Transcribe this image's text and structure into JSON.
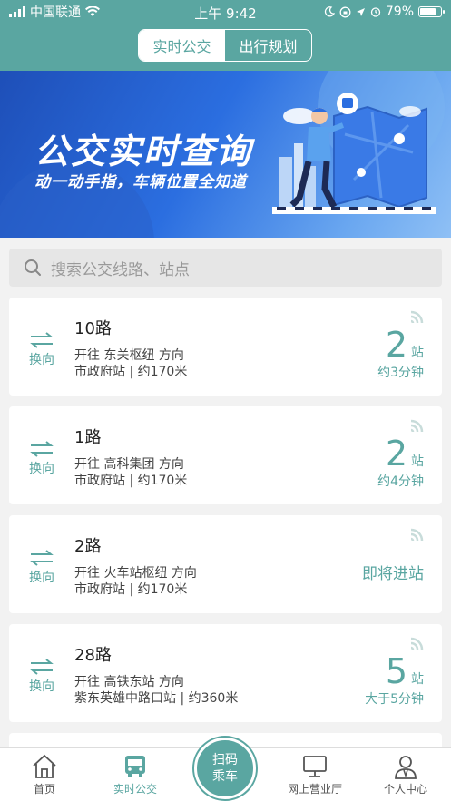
{
  "status": {
    "carrier": "中国联通",
    "time": "上午 9:42",
    "battery": "79%",
    "battery_level": 0.79
  },
  "segment": {
    "tabs": [
      "实时公交",
      "出行规划"
    ],
    "active_index": 0
  },
  "banner": {
    "title": "公交实时查询",
    "subtitle": "动一动手指，车辆位置全知道"
  },
  "search": {
    "placeholder": "搜索公交线路、站点"
  },
  "routes": [
    {
      "switch_label": "换向",
      "name": "10路",
      "direction": "开往 东关枢纽 方向",
      "stop": "市政府站 | 约170米",
      "stops": "2",
      "unit": "站",
      "eta": "约3分钟"
    },
    {
      "switch_label": "换向",
      "name": "1路",
      "direction": "开往 高科集团 方向",
      "stop": "市政府站 | 约170米",
      "stops": "2",
      "unit": "站",
      "eta": "约4分钟"
    },
    {
      "switch_label": "换向",
      "name": "2路",
      "direction": "开往 火车站枢纽 方向",
      "stop": "市政府站 | 约170米",
      "status": "即将进站"
    },
    {
      "switch_label": "换向",
      "name": "28路",
      "direction": "开往 高铁东站 方向",
      "stop": "紫东英雄中路口站 | 约360米",
      "stops": "5",
      "unit": "站",
      "eta": "大于5分钟"
    }
  ],
  "tabbar": {
    "home": "首页",
    "realtime": "实时公交",
    "scan_line1": "扫码",
    "scan_line2": "乘车",
    "hall": "网上营业厅",
    "profile": "个人中心"
  },
  "colors": {
    "accent": "#5aa6a1",
    "banner": "#2b6ee0"
  }
}
